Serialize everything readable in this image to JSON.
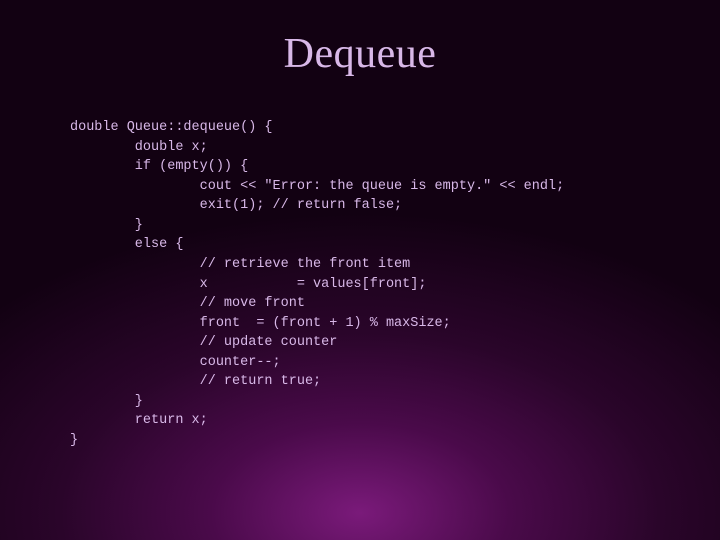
{
  "title": "Dequeue",
  "code_lines": {
    "l0": "double Queue::dequeue() {",
    "l1": "        double x;",
    "l2": "        if (empty()) {",
    "l3": "                cout << \"Error: the queue is empty.\" << endl;",
    "l4": "                exit(1); // return false;",
    "l5": "        }",
    "l6": "        else {",
    "l7": "                // retrieve the front item",
    "l8": "                x           = values[front];",
    "l9": "                // move front",
    "l10": "                front  = (front + 1) % maxSize;",
    "l11": "                // update counter",
    "l12": "                counter--;",
    "l13": "                // return true;",
    "l14": "        }",
    "l15": "        return x;",
    "l16": "}"
  }
}
